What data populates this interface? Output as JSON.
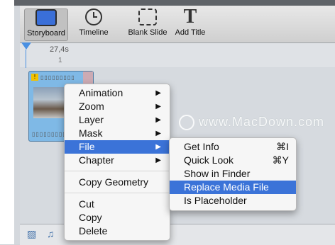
{
  "toolbar": {
    "storyboard": "Storyboard",
    "timeline": "Timeline",
    "blank_slide": "Blank Slide",
    "add_title": "Add Title",
    "title_glyph": "T"
  },
  "ruler": {
    "time": "27,4s",
    "marker": "1"
  },
  "clip": {
    "holes": "▯▯▯▯▯▯▯▯▯",
    "warning": "!"
  },
  "watermark": "www.MacDown.com",
  "context_menu": {
    "items": [
      "Animation",
      "Zoom",
      "Layer",
      "Mask",
      "File",
      "Chapter",
      "Copy Geometry",
      "Cut",
      "Copy",
      "Delete"
    ],
    "arrow": "▶"
  },
  "file_submenu": {
    "items": [
      {
        "label": "Get Info",
        "shortcut": "⌘I"
      },
      {
        "label": "Quick Look",
        "shortcut": "⌘Y"
      },
      {
        "label": "Show in Finder",
        "shortcut": ""
      },
      {
        "label": "Replace Media File",
        "shortcut": ""
      },
      {
        "label": "Is Placeholder",
        "shortcut": ""
      }
    ]
  },
  "colors": {
    "accent": "#3b73d8"
  },
  "icons": {
    "bottom_left": "photo-icon",
    "bottom_right": "music-note-icon"
  }
}
